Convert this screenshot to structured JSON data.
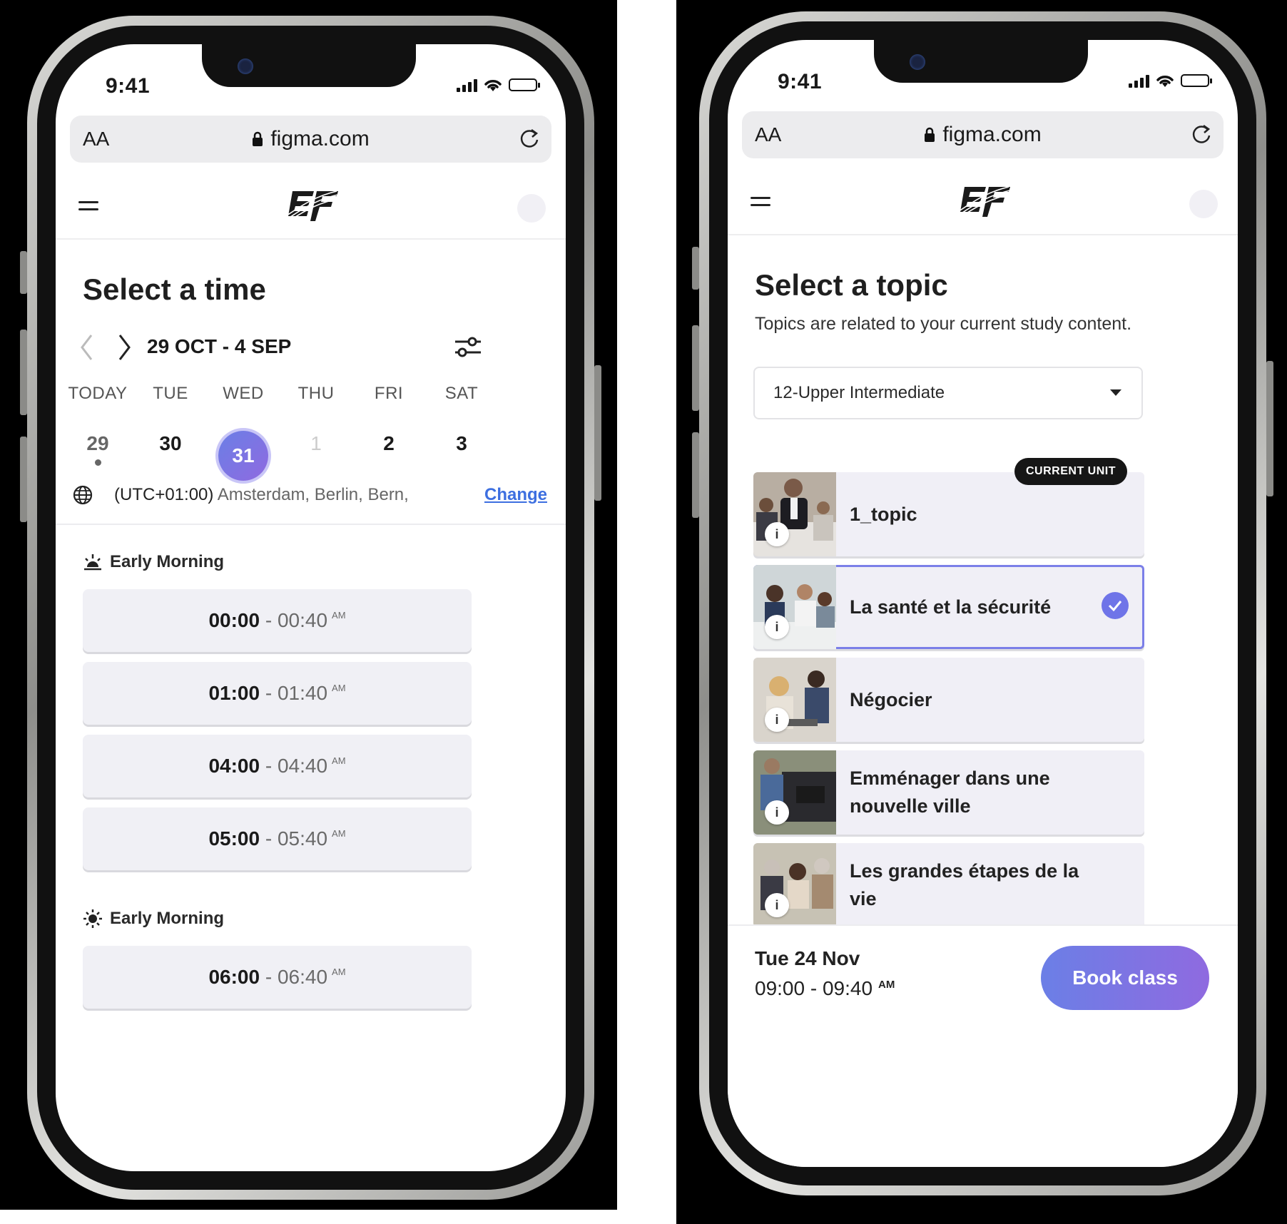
{
  "status_bar": {
    "time": "9:41"
  },
  "browser": {
    "aa_label": "AA",
    "url": "figma.com"
  },
  "left_screen": {
    "title": "Select a time",
    "date_range": "29 OCT - 4 SEP",
    "days": [
      {
        "name": "TODAY",
        "num": "29"
      },
      {
        "name": "TUE",
        "num": "30"
      },
      {
        "name": "WED",
        "num": "31"
      },
      {
        "name": "THU",
        "num": "1"
      },
      {
        "name": "FRI",
        "num": "2"
      },
      {
        "name": "SAT",
        "num": "3"
      }
    ],
    "timezone_offset": "(UTC+01:00)",
    "timezone_cities": "Amsterdam, Berlin, Bern,",
    "change_label": "Change",
    "sections": [
      {
        "label": "Early Morning",
        "slots": [
          {
            "start": "00:00",
            "end": "00:40",
            "period": "AM"
          },
          {
            "start": "01:00",
            "end": "01:40",
            "period": "AM"
          },
          {
            "start": "04:00",
            "end": "04:40",
            "period": "AM"
          },
          {
            "start": "05:00",
            "end": "05:40",
            "period": "AM"
          }
        ]
      },
      {
        "label": "Early Morning",
        "slots": [
          {
            "start": "06:00",
            "end": "06:40",
            "period": "AM"
          }
        ]
      }
    ]
  },
  "right_screen": {
    "title": "Select a topic",
    "subtitle": "Topics are related to your current study content.",
    "level_select": "12-Upper Intermediate",
    "current_unit_badge": "CURRENT UNIT",
    "info_label": "i",
    "topics": [
      {
        "name": "1_topic"
      },
      {
        "name": "La santé et la sécurité"
      },
      {
        "name": "Négocier"
      },
      {
        "name": "Emménager dans une nouvelle ville"
      },
      {
        "name": "Les grandes étapes de la vie"
      }
    ],
    "footer_date": "Tue 24 Nov",
    "footer_time": "09:00 - 09:40",
    "footer_period": "AM",
    "book_label": "Book class"
  },
  "colors": {
    "accent": "#6f74e8",
    "link": "#3d6fe0",
    "slot_bg": "#f0f0f5"
  }
}
